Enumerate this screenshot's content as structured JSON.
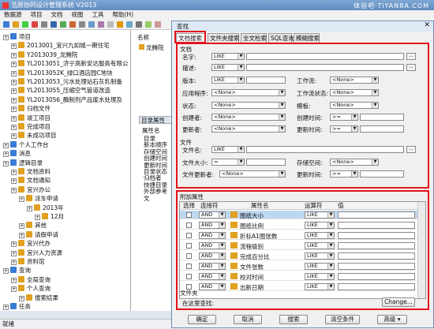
{
  "app": {
    "title": "浩辰协同设计管理系统 V2013",
    "watermark": "体验吧·TiYAN8A.COM"
  },
  "menu": [
    "数据源",
    "项目",
    "文档",
    "视图",
    "工具",
    "帮助(H)"
  ],
  "tree": [
    {
      "label": "项目",
      "depth": 0
    },
    {
      "label": "2013001_宜兴九如城一期住宅",
      "depth": 1
    },
    {
      "label": "Y2013039_龙腾院",
      "depth": 1
    },
    {
      "label": "YL2013051_济宁高新安达服务有限公",
      "depth": 1
    },
    {
      "label": "YL2013052K_绿口酒店园C地块",
      "depth": 1
    },
    {
      "label": "YL2013053_污水处理站石灰乳制备",
      "depth": 1
    },
    {
      "label": "YL2013055_压缩空气管道改造",
      "depth": 1
    },
    {
      "label": "YL2013056_酶制剂产品废水处理及",
      "depth": 1
    },
    {
      "label": "归档文件",
      "depth": 1
    },
    {
      "label": "竣工项目",
      "depth": 1
    },
    {
      "label": "完成项目",
      "depth": 1
    },
    {
      "label": "未成功项目",
      "depth": 1
    },
    {
      "label": "个人工作台",
      "depth": 0
    },
    {
      "label": "消息",
      "depth": 0
    },
    {
      "label": "逻辑目录",
      "depth": 0
    },
    {
      "label": "文档资料",
      "depth": 1
    },
    {
      "label": "文档通知",
      "depth": 1
    },
    {
      "label": "宜兴办公",
      "depth": 1
    },
    {
      "label": "派车申请",
      "depth": 2
    },
    {
      "label": "2013年",
      "depth": 3
    },
    {
      "label": "12月",
      "depth": 4
    },
    {
      "label": "其他",
      "depth": 2
    },
    {
      "label": "请假申请",
      "depth": 2
    },
    {
      "label": "宜兴代办",
      "depth": 1
    },
    {
      "label": "宜兴人力资源",
      "depth": 1
    },
    {
      "label": "资料馆",
      "depth": 1
    },
    {
      "label": "查询",
      "depth": 0
    },
    {
      "label": "全局查询",
      "depth": 1
    },
    {
      "label": "个人查询",
      "depth": 1
    },
    {
      "label": "搜索结果",
      "depth": 2
    },
    {
      "label": "任务",
      "depth": 0
    }
  ],
  "midpanel": {
    "header": "名称",
    "item": "龙腾院",
    "props_header": "目录属性",
    "props_col": "属性名",
    "props": [
      "目录",
      "新本顺序",
      "存储空间",
      "创建时间",
      "更新时间",
      "目录状态",
      "归档者",
      "快捷目录",
      "外部参考文"
    ]
  },
  "status": "就绪",
  "dialog": {
    "title": "查找",
    "close": "✕",
    "tabs": [
      "文档搜索",
      "文件夹搜索",
      "全文检索",
      "SQL查询",
      "模糊搜索"
    ],
    "doc_section": "文档",
    "file_section": "文件",
    "attr_section": "附加属性",
    "folder_section": "文件夹",
    "fields": {
      "name": "名字:",
      "desc": "描述:",
      "version": "版本:",
      "workflow": "工作流:",
      "app": "应用程序:",
      "workflow_state": "工作流状态:",
      "state": "状态:",
      "template": "模板:",
      "creator": "创建者:",
      "create_time": "创建时间:",
      "updater": "更新者:",
      "update_time": "更新时间:",
      "file_name": "文件名:",
      "file_size": "文件大小:",
      "storage": "存储空间:",
      "file_updater": "文件更新者:",
      "file_update_time": "更新时间:"
    },
    "values": {
      "like": "LIKE",
      "none": "<None>",
      "gte": ">=",
      "eq": "="
    },
    "grid_headers": [
      "选择",
      "连接符",
      "属性名",
      "运算符",
      "值"
    ],
    "grid_rows": [
      {
        "conn": "AND",
        "name": "图纸大小",
        "op": "LIKE"
      },
      {
        "conn": "AND",
        "name": "图纸比例",
        "op": "LIKE"
      },
      {
        "conn": "AND",
        "name": "折标A1图张数",
        "op": "LIKE"
      },
      {
        "conn": "AND",
        "name": "流程级别",
        "op": "LIKE"
      },
      {
        "conn": "AND",
        "name": "完成百分比",
        "op": "LIKE"
      },
      {
        "conn": "AND",
        "name": "文件张数",
        "op": "LIKE"
      },
      {
        "conn": "AND",
        "name": "校对时间",
        "op": "LIKE"
      },
      {
        "conn": "AND",
        "name": "出新日期",
        "op": "LIKE"
      }
    ],
    "search_in": "在这里查找:",
    "change": "Change...",
    "buttons": {
      "ok": "确定",
      "cancel": "取消",
      "search": "搜索",
      "clear": "清空条件",
      "advanced": "高级"
    }
  }
}
